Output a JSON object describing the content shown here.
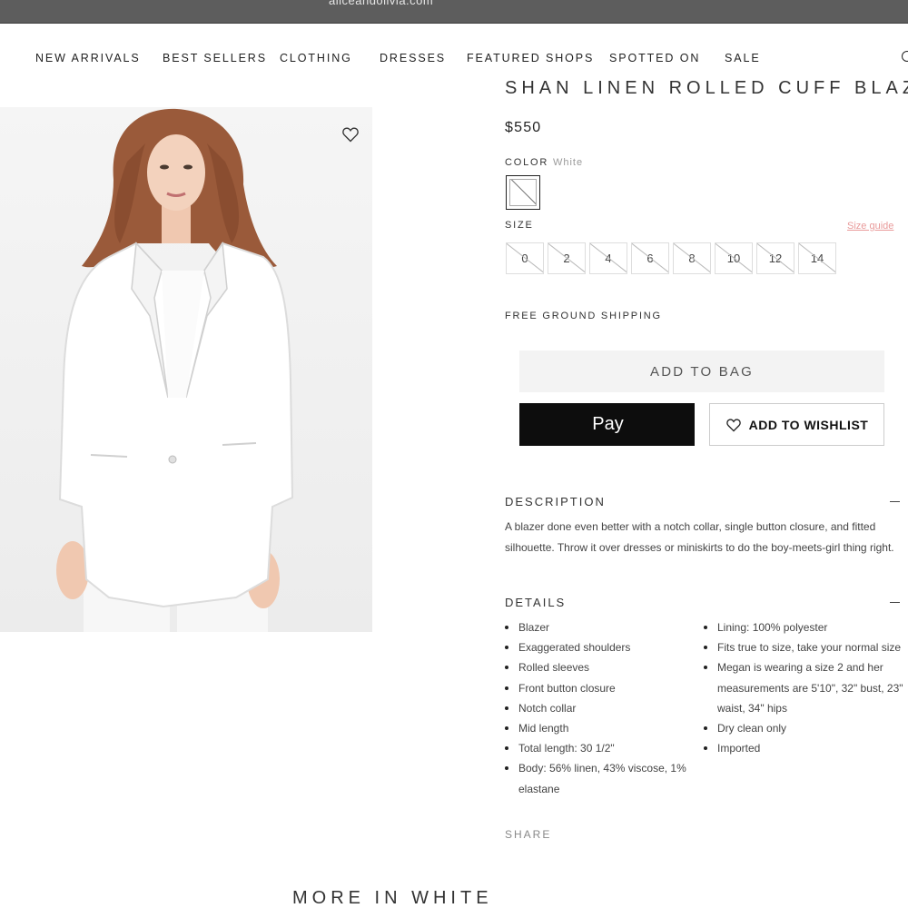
{
  "browser": {
    "url": "aliceandolivia.com"
  },
  "nav": {
    "items": [
      {
        "label": "NEW ARRIVALS"
      },
      {
        "label": "BEST SELLERS"
      },
      {
        "label": "CLOTHING"
      },
      {
        "label": "DRESSES"
      },
      {
        "label": "FEATURED SHOPS"
      },
      {
        "label": "SPOTTED ON"
      },
      {
        "label": "SALE"
      }
    ],
    "search_icon": "search-icon"
  },
  "product": {
    "title": "SHAN LINEN ROLLED CUFF BLAZER",
    "price": "$550",
    "color_label": "COLOR",
    "color_value": "White",
    "size_label": "SIZE",
    "size_guide": "Size guide",
    "sizes": [
      "0",
      "2",
      "4",
      "6",
      "8",
      "10",
      "12",
      "14"
    ],
    "shipping": "FREE GROUND SHIPPING",
    "add_to_bag": "ADD TO BAG",
    "apple_pay": "Pay",
    "add_to_wishlist": "ADD TO WISHLIST"
  },
  "description": {
    "heading": "DESCRIPTION",
    "text": "A blazer done even better with a notch collar, single button closure, and fitted silhouette. Throw it over dresses or miniskirts to do the boy-meets-girl thing right."
  },
  "details": {
    "heading": "DETAILS",
    "left": [
      "Blazer",
      "Exaggerated shoulders",
      "Rolled sleeves",
      "Front button closure",
      "Notch collar",
      "Mid length",
      "Total length: 30 1/2\"",
      "Body: 56% linen, 43% viscose, 1% elastane"
    ],
    "right": [
      "Lining: 100% polyester",
      "Fits true to size, take your normal size",
      "Megan is wearing a size 2 and her measurements are 5'10\", 32\" bust, 23\" waist, 34\" hips",
      "Dry clean only",
      "Imported"
    ]
  },
  "share": "SHARE",
  "more_title": "MORE IN WHITE",
  "colors": {
    "apple_pay_bg": "#0d0d0d",
    "add_to_bag_bg": "#f3f3f3",
    "size_guide": "#e99a9a"
  }
}
